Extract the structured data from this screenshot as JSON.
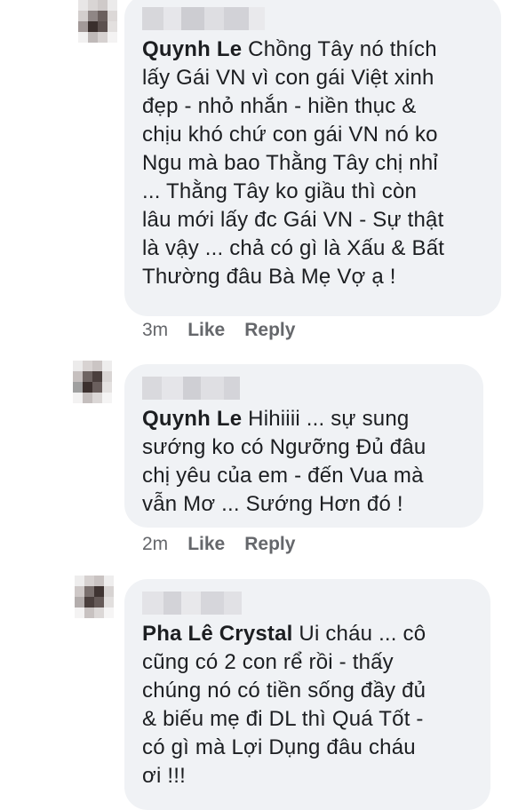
{
  "comments": [
    {
      "author": "Quynh Le",
      "text": "Chồng Tây nó thích\nlấy Gái VN vì con gái Việt xinh\nđẹp - nhỏ nhắn - hiền thục &\nchịu khó chứ con gái VN nó ko\nNgu mà bao Thằng Tây chị nhỉ\n... Thằng Tây ko giầu thì còn\nlâu mới lấy đc Gái VN - Sự thật\nlà vậy ... chả có gì là Xấu & Bất\nThường đâu Bà Mẹ Vợ ạ !",
      "time": "3m",
      "like": "Like",
      "reply": "Reply"
    },
    {
      "author": "Quynh Le",
      "text": "Hihiiii ... sự sung\nsướng ko có Ngưỡng Đủ đâu\nchị yêu của em - đến Vua mà\nvẫn Mơ ... Sướng Hơn đó !",
      "time": "2m",
      "like": "Like",
      "reply": "Reply"
    },
    {
      "author": "Pha Lê Crystal",
      "text": "Ui cháu ... cô\ncũng có 2 con rể rồi - thấy\nchúng nó có tiền sống đầy đủ\n& biếu mẹ đi DL thì Quá Tốt -\ncó gì mà Lợi Dụng đâu cháu\nơi !!!"
    }
  ]
}
